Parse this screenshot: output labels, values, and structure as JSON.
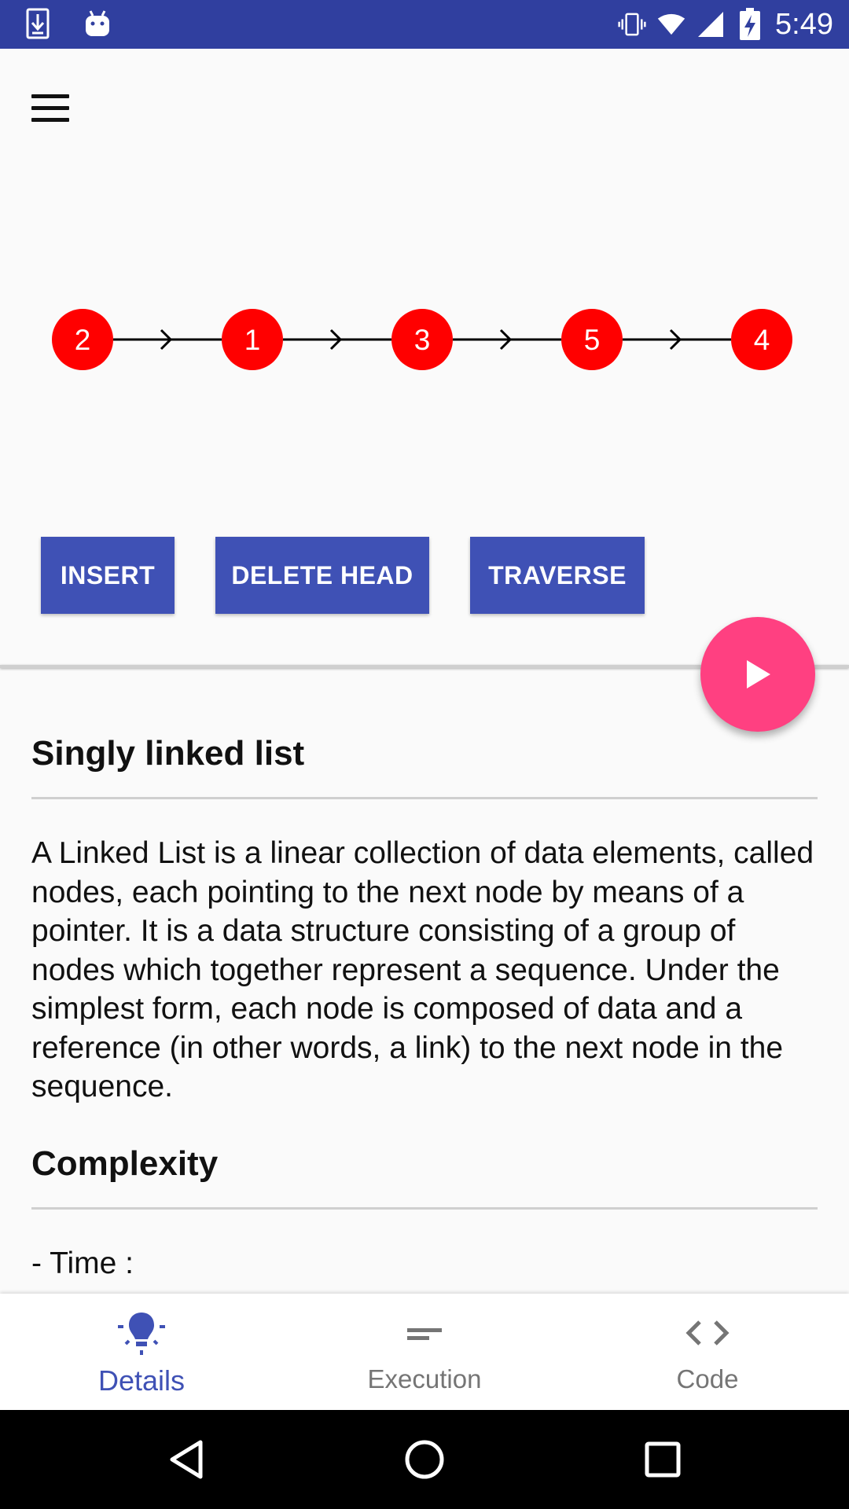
{
  "status_bar": {
    "time": "5:49",
    "icons": [
      "download-icon",
      "android-icon",
      "vibrate-icon",
      "wifi-icon",
      "signal-icon",
      "battery-charging-icon"
    ],
    "background": "#303f9f"
  },
  "toolbar": {
    "menu_icon": "hamburger-menu-icon"
  },
  "linked_list": {
    "nodes": [
      "2",
      "1",
      "3",
      "5",
      "4"
    ],
    "node_color": "#ff0000",
    "node_text_color": "#ffffff"
  },
  "actions": {
    "insert_label": "INSERT",
    "delete_head_label": "DELETE HEAD",
    "traverse_label": "TRAVERSE",
    "button_color": "#3f51b5"
  },
  "fab": {
    "icon": "play-icon",
    "color": "#ff4081"
  },
  "content": {
    "title": "Singly linked list",
    "description": "A Linked List is a linear collection of data elements, called nodes, each pointing to the next node by means of a pointer. It is a data structure consisting of a group of nodes which together represent a sequence. Under the simplest form, each node is composed of data and a reference (in other words, a link) to the next node in the sequence.",
    "complexity_title": "Complexity",
    "time_label": "- Time :"
  },
  "bottom_nav": {
    "items": [
      {
        "label": "Details",
        "icon": "lightbulb-icon",
        "active": true
      },
      {
        "label": "Execution",
        "icon": "short-text-icon",
        "active": false
      },
      {
        "label": "Code",
        "icon": "code-icon",
        "active": false
      }
    ],
    "active_color": "#3f51b5",
    "inactive_color": "#757575"
  },
  "system_nav": {
    "icons": [
      "back-icon",
      "home-icon",
      "recents-icon"
    ]
  }
}
